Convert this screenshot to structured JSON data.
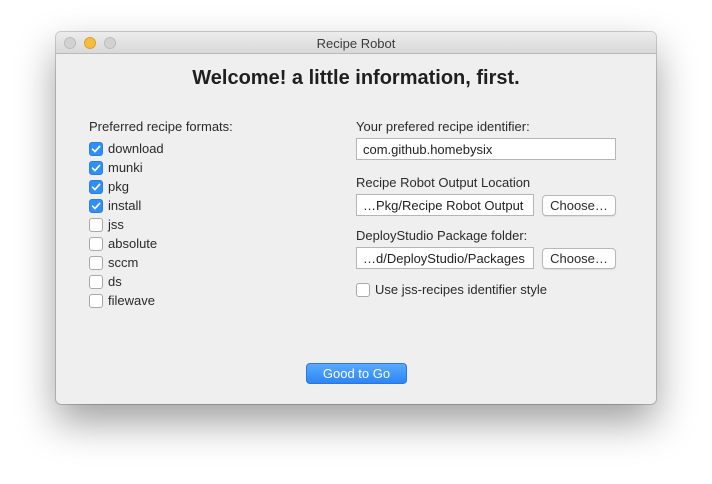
{
  "window": {
    "title": "Recipe Robot"
  },
  "heading": "Welcome! a little information, first.",
  "formats": {
    "label": "Preferred recipe formats:",
    "items": [
      {
        "label": "download",
        "checked": true
      },
      {
        "label": "munki",
        "checked": true
      },
      {
        "label": "pkg",
        "checked": true
      },
      {
        "label": "install",
        "checked": true
      },
      {
        "label": "jss",
        "checked": false
      },
      {
        "label": "absolute",
        "checked": false
      },
      {
        "label": "sccm",
        "checked": false
      },
      {
        "label": "ds",
        "checked": false
      },
      {
        "label": "filewave",
        "checked": false
      }
    ]
  },
  "identifier": {
    "label": "Your prefered recipe identifier:",
    "value": "com.github.homebysix"
  },
  "output_location": {
    "label": "Recipe Robot Output Location",
    "value": "…Pkg/Recipe Robot Output",
    "button": "Choose…"
  },
  "deploystudio": {
    "label": "DeployStudio Package folder:",
    "value": "…d/DeployStudio/Packages",
    "button": "Choose…"
  },
  "jss_style": {
    "label": "Use jss-recipes identifier style",
    "checked": false
  },
  "primary_button": "Good to Go",
  "colors": {
    "accent": "#2f8ef7",
    "window_bg": "#efefef"
  }
}
